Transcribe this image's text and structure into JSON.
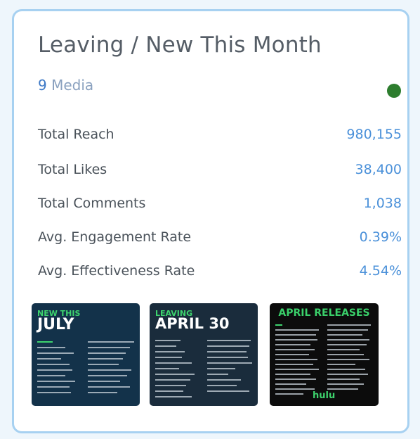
{
  "card": {
    "title": "Leaving / New This Month",
    "count": "9",
    "count_label": "Media",
    "status_color": "#2d7d2e"
  },
  "stats": [
    {
      "label": "Total Reach",
      "value": "980,155"
    },
    {
      "label": "Total Likes",
      "value": "38,400"
    },
    {
      "label": "Total Comments",
      "value": "1,038"
    },
    {
      "label": "Avg. Engagement Rate",
      "value": "0.39%"
    },
    {
      "label": "Avg. Effectiveness Rate",
      "value": "4.54%"
    }
  ],
  "media": [
    {
      "line1": "NEW THIS",
      "line2": "JULY"
    },
    {
      "line1": "LEAVING",
      "line2": "APRIL 30"
    },
    {
      "line1": "APRIL RELEASES",
      "line2": "hulu"
    }
  ]
}
